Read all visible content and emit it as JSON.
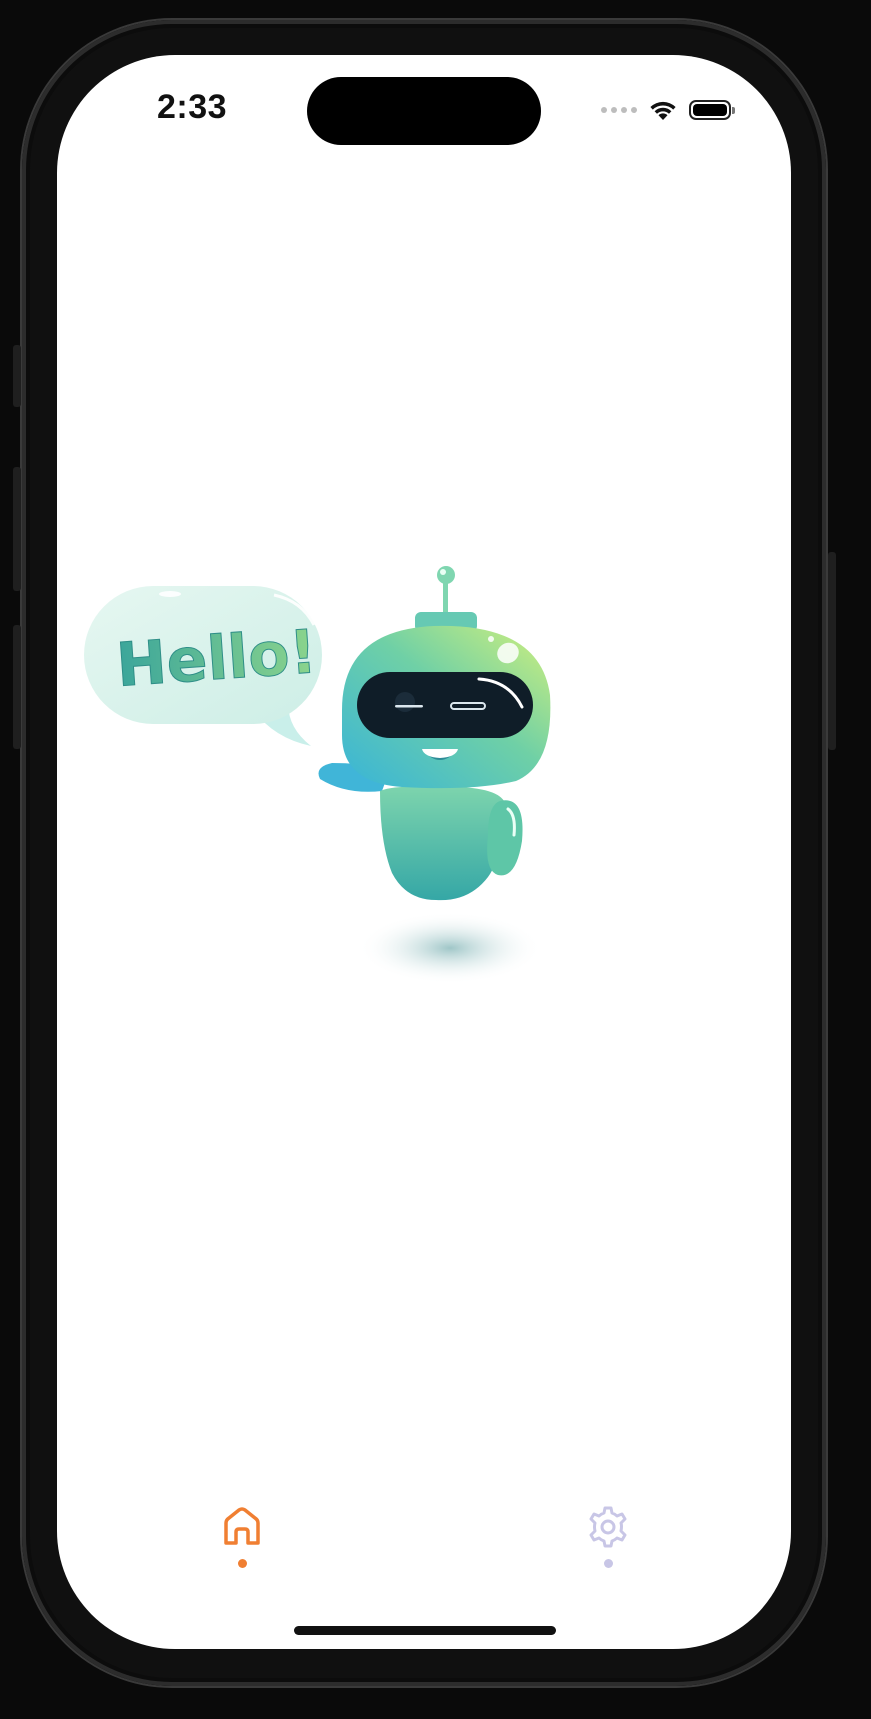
{
  "status_bar": {
    "time": "2:33",
    "signal_icon": "cellular-signal-icon",
    "wifi_icon": "wifi-icon",
    "battery_icon": "battery-icon"
  },
  "illustration": {
    "speech_bubble_text": "Hello!",
    "character": "robot-mascot"
  },
  "tab_bar": {
    "active_color": "#f07f32",
    "inactive_color": "#c8c6e6",
    "tabs": [
      {
        "icon": "home-icon",
        "active": true
      },
      {
        "icon": "gear-icon",
        "active": false
      }
    ]
  }
}
